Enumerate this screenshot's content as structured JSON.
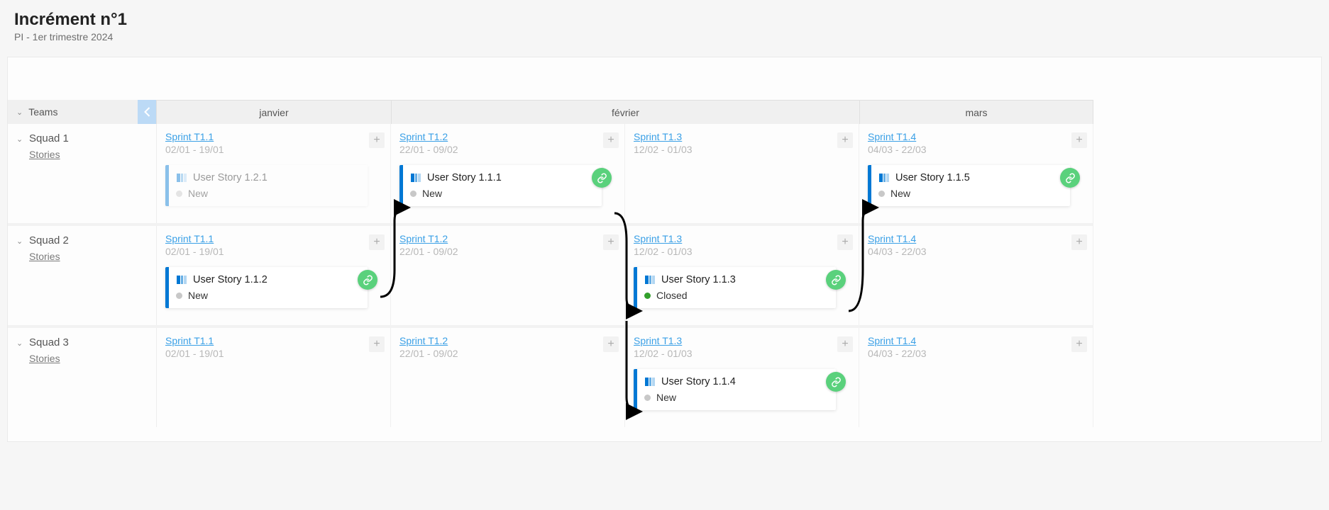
{
  "header": {
    "title": "Incrément n°1",
    "subtitle": "PI - 1er trimestre 2024"
  },
  "teamsHeader": "Teams",
  "storiesLabel": "Stories",
  "months": [
    "janvier",
    "février",
    "mars"
  ],
  "sprints": {
    "s1": {
      "name": "Sprint T1.1",
      "dates": "02/01 - 19/01"
    },
    "s2": {
      "name": "Sprint T1.2",
      "dates": "22/01 - 09/02"
    },
    "s3": {
      "name": "Sprint T1.3",
      "dates": "12/02 - 01/03"
    },
    "s4": {
      "name": "Sprint T1.4",
      "dates": "04/03 - 22/03"
    }
  },
  "squads": [
    "Squad 1",
    "Squad 2",
    "Squad 3"
  ],
  "cards": {
    "c121": {
      "title": "User Story 1.2.1",
      "status": "New"
    },
    "c111": {
      "title": "User Story 1.1.1",
      "status": "New"
    },
    "c115": {
      "title": "User Story 1.1.5",
      "status": "New"
    },
    "c112": {
      "title": "User Story 1.1.2",
      "status": "New"
    },
    "c113": {
      "title": "User Story 1.1.3",
      "status": "Closed"
    },
    "c114": {
      "title": "User Story 1.1.4",
      "status": "New"
    }
  },
  "colors": {
    "accent": "#0078d4",
    "link": "#3aa0e6",
    "badge": "#5ad17c",
    "closed": "#33a02c"
  }
}
